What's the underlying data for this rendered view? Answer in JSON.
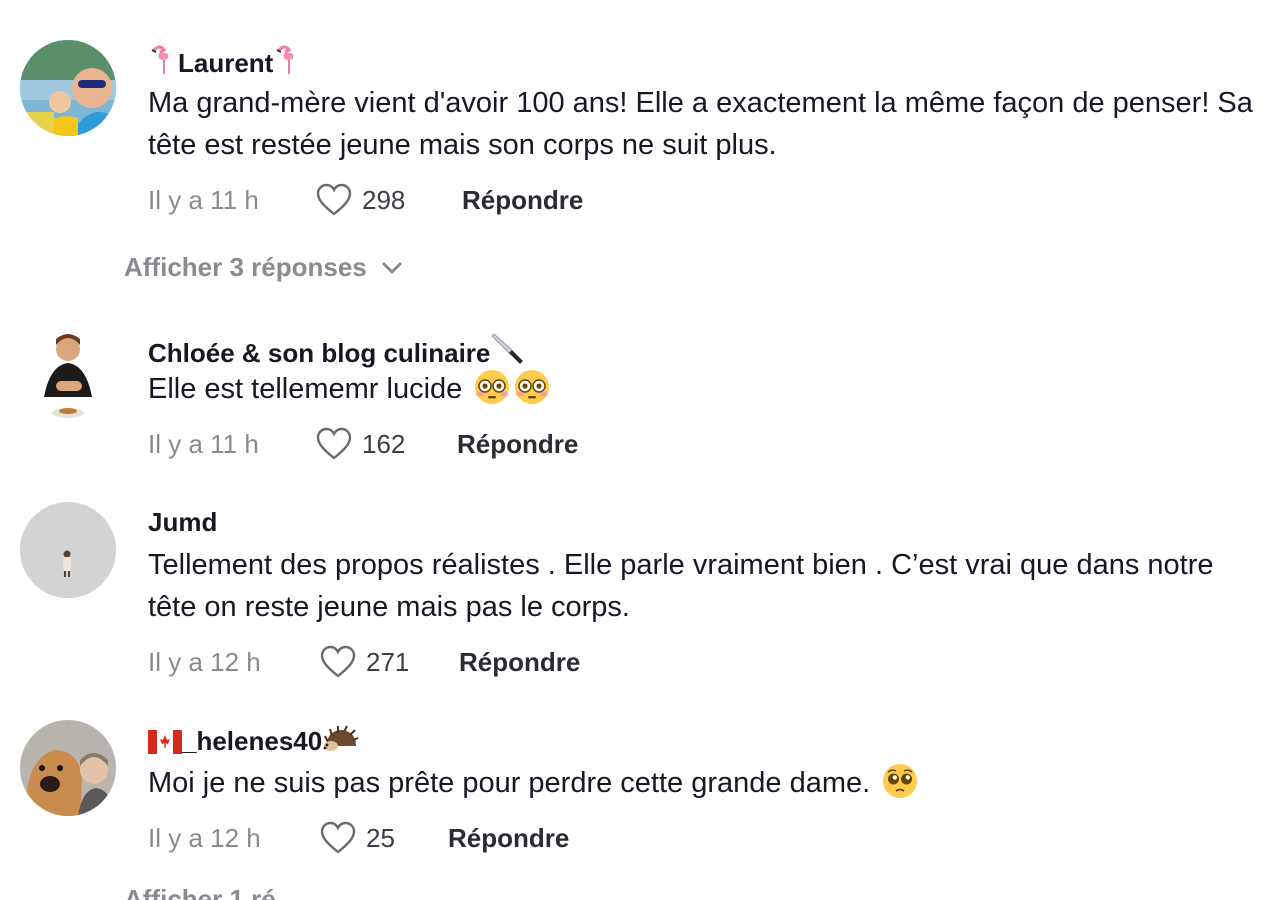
{
  "comments": [
    {
      "username": "Laurent",
      "text": "Ma grand-mère vient d'avoir 100 ans! Elle a exactement la même façon de penser! Sa tête est restée jeune mais son corps ne suit plus.",
      "time": "Il y a 11 h",
      "likes": "298",
      "reply_label": "Répondre",
      "icons": [
        "flamingo-icon",
        "flamingo-icon"
      ]
    },
    {
      "username": "Chloée & son blog culinaire",
      "text": "Elle est tellememr lucide",
      "time": "Il y a 11 h",
      "likes": "162",
      "reply_label": "Répondre",
      "icons": [
        "knife-icon",
        "flushed-face-icon",
        "flushed-face-icon"
      ]
    },
    {
      "username": "Jumd",
      "text": "Tellement des propos réalistes . Elle parle vraiment bien . C’est vrai que dans notre tête on reste jeune mais pas le corps.",
      "time": "Il y a 12 h",
      "likes": "271",
      "reply_label": "Répondre"
    },
    {
      "username": "_helenes40",
      "text": "Moi je ne suis pas prête pour perdre cette grande dame.",
      "time": "Il y a 12 h",
      "likes": "25",
      "reply_label": "Répondre",
      "icons": [
        "canada-flag-icon",
        "hedgehog-icon",
        "pleading-face-icon"
      ]
    }
  ],
  "show_replies": [
    {
      "label": "Afficher 3 réponses"
    },
    {
      "label": "Afficher 1 ré"
    }
  ],
  "colors": {
    "primary_text": "#161823",
    "secondary_text": "#8a8b91",
    "background": "#ffffff"
  }
}
